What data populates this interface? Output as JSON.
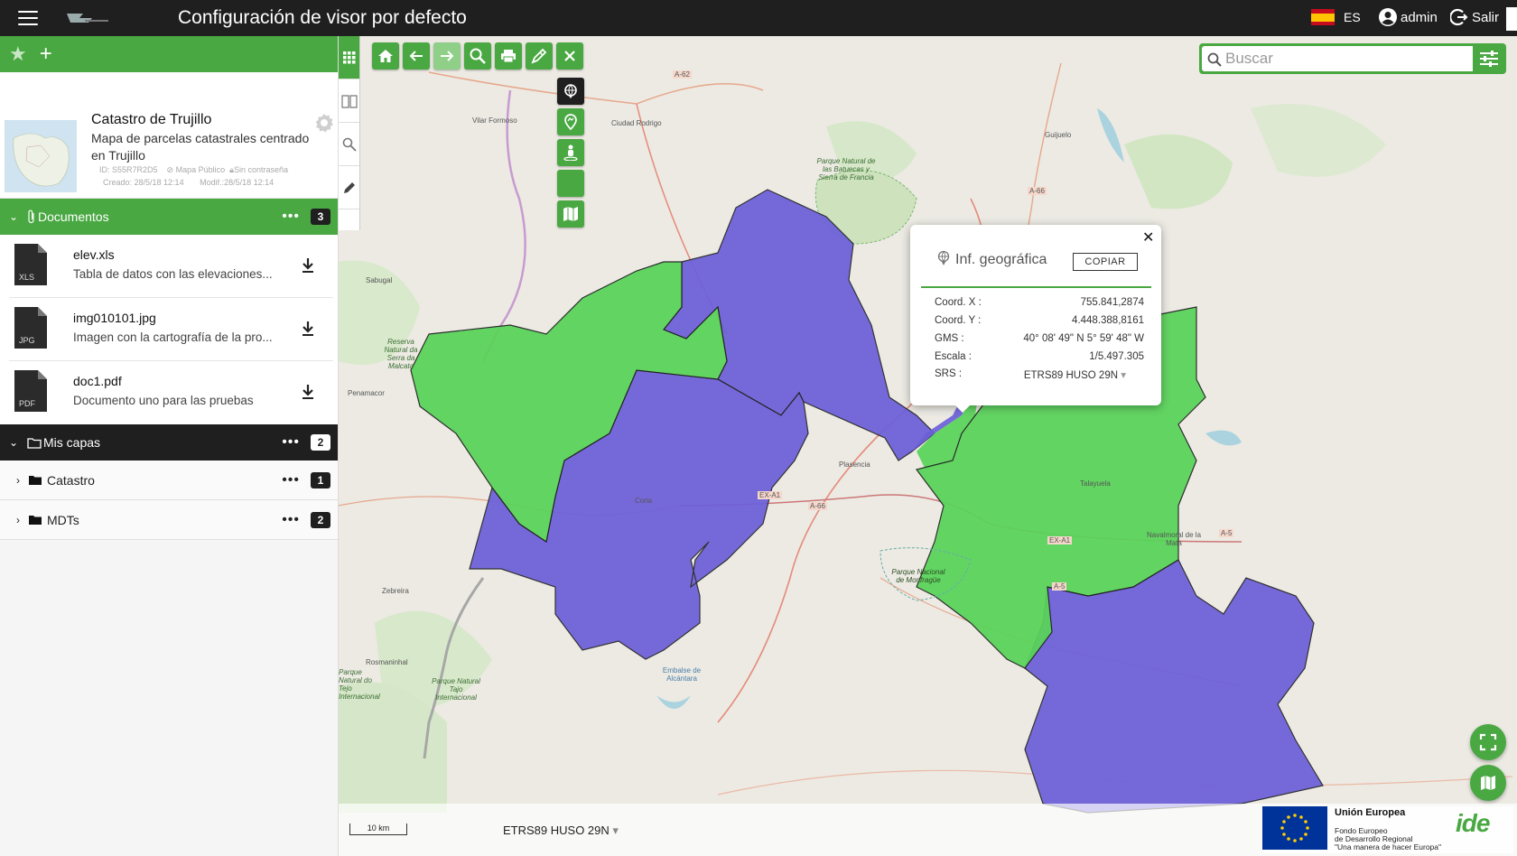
{
  "topbar": {
    "title": "Configuración de visor por defecto",
    "language": "ES",
    "user": "admin",
    "logout": "Salir"
  },
  "panel": {
    "map_card": {
      "title": "Catastro de Trujillo",
      "description": "Mapa de parcelas catastrales centrado en Trujillo",
      "id": "ID: S55R7R2D5",
      "visibility": "Mapa Público",
      "password": "Sin contraseña",
      "created": "Creado: 28/5/18 12:14",
      "modified": "Modif.:28/5/18 12:14"
    },
    "documents": {
      "label": "Documentos",
      "count": "3",
      "items": [
        {
          "name": "elev.xls",
          "desc": "Tabla de datos con las elevaciones...",
          "type": "XLS"
        },
        {
          "name": "img010101.jpg",
          "desc": "Imagen con la cartografía de la pro...",
          "type": "JPG"
        },
        {
          "name": "doc1.pdf",
          "desc": "Documento uno para las pruebas",
          "type": "PDF"
        }
      ]
    },
    "layers": {
      "label": "Mis capas",
      "count": "2",
      "items": [
        {
          "name": "Catastro",
          "count": "1"
        },
        {
          "name": "MDTs",
          "count": "2"
        }
      ]
    }
  },
  "search": {
    "placeholder": "Buscar"
  },
  "popup": {
    "title": "Inf. geográfica",
    "copy": "COPIAR",
    "rows": [
      {
        "label": "Coord. X :",
        "value": "755.841,2874"
      },
      {
        "label": "Coord. Y :",
        "value": "4.448.388,8161"
      },
      {
        "label": "GMS :",
        "value": "40° 08' 49\" N 5° 59' 48\" W"
      },
      {
        "label": "Escala :",
        "value": "1/5.497.305"
      },
      {
        "label": "SRS :",
        "value": "ETRS89 HUSO 29N"
      }
    ]
  },
  "bottom": {
    "scale": "10 km",
    "srs": "ETRS89 HUSO 29N",
    "eu_title": "Unión Europea",
    "eu_line1": "Fondo Europeo",
    "eu_line2": "de Desarrollo Regional",
    "eu_line3": "\"Una manera de hacer Europa\"",
    "ide": "ide"
  },
  "map_labels": {
    "vilar": "Vilar Formoso",
    "ciudad_rodrigo": "Ciudad Rodrigo",
    "guijuelo": "Guijuelo",
    "sabugal": "Sabugal",
    "penamacor": "Penamacor",
    "plasencia": "Plasencia",
    "coria": "Coria",
    "talayuela": "Talayuela",
    "navalmoral": "Navalmoral de la Mata",
    "zebreira": "Zebreira",
    "rosmaninhal": "Rosmaninhal",
    "alcantara": "Embalse de Alcántara",
    "batuecas": "Parque Natural de las Batuecas y Sierra de Francia",
    "malcata": "Reserva Natural da Serra da Malcata",
    "monfrague": "Parque Nacional de Monfragüe",
    "tajo_int": "Parque Natural Tajo Internacional",
    "tajo_pt": "Parque Natural do Tejo Internacional",
    "a62": "A-62",
    "a66": "A-66",
    "a66b": "A-66",
    "exa1": "EX-A1",
    "exa1b": "EX-A1",
    "a5": "A-5",
    "a5b": "A-5"
  },
  "colors": {
    "accent": "#49a842",
    "dark": "#1f1f1f",
    "region_blue": "#6b5fd9",
    "region_green": "#5ad35a"
  }
}
